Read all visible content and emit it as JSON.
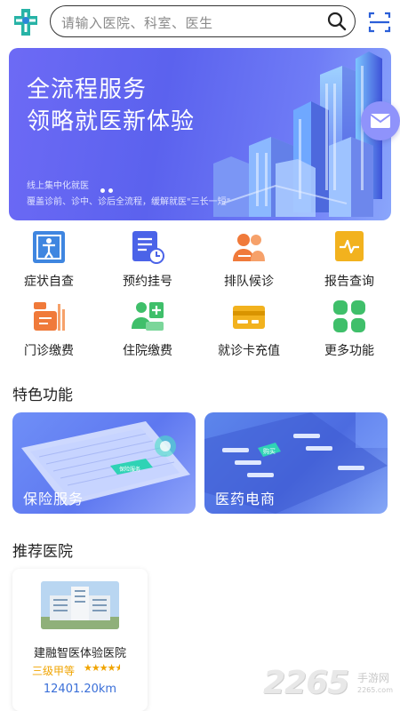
{
  "search": {
    "placeholder": "请输入医院、科室、医生"
  },
  "banner": {
    "title_line1": "全流程服务",
    "title_line2": "领略就医新体验",
    "sub_line1": "线上集中化就医",
    "sub_line2": "覆盖诊前、诊中、诊后全流程，缓解就医\"三长一短\""
  },
  "functions": [
    {
      "label": "症状自查",
      "icon": "body-check-icon",
      "color": "#3f86e0"
    },
    {
      "label": "预约挂号",
      "icon": "appointment-icon",
      "color": "#4b63e8"
    },
    {
      "label": "排队候诊",
      "icon": "queue-icon",
      "color": "#f07a3a"
    },
    {
      "label": "报告查询",
      "icon": "report-icon",
      "color": "#f2b21e"
    },
    {
      "label": "门诊缴费",
      "icon": "outpatient-pay-icon",
      "color": "#f07a3a"
    },
    {
      "label": "住院缴费",
      "icon": "inpatient-pay-icon",
      "color": "#3fbf6a"
    },
    {
      "label": "就诊卡充值",
      "icon": "card-recharge-icon",
      "color": "#f2b21e"
    },
    {
      "label": "更多功能",
      "icon": "more-icon",
      "color": "#3fbf6a"
    }
  ],
  "featured": {
    "title": "特色功能",
    "cards": [
      {
        "label": "保险服务",
        "tag": "保险服务"
      },
      {
        "label": "医药电商",
        "tag": "购买"
      }
    ]
  },
  "recommended": {
    "title": "推荐医院",
    "hospital": {
      "name": "建融智医体验医院",
      "level": "三级甲等",
      "rating": 4.5,
      "distance": "12401.20km"
    }
  },
  "watermark": {
    "number": "2265",
    "suffix": ".com",
    "cn": "手游网",
    "url": "2265.com"
  },
  "colors": {
    "accent": "#5b62ee",
    "logo": "#27b3a6",
    "distance": "#3a6fd8",
    "level": "#f0a400"
  }
}
